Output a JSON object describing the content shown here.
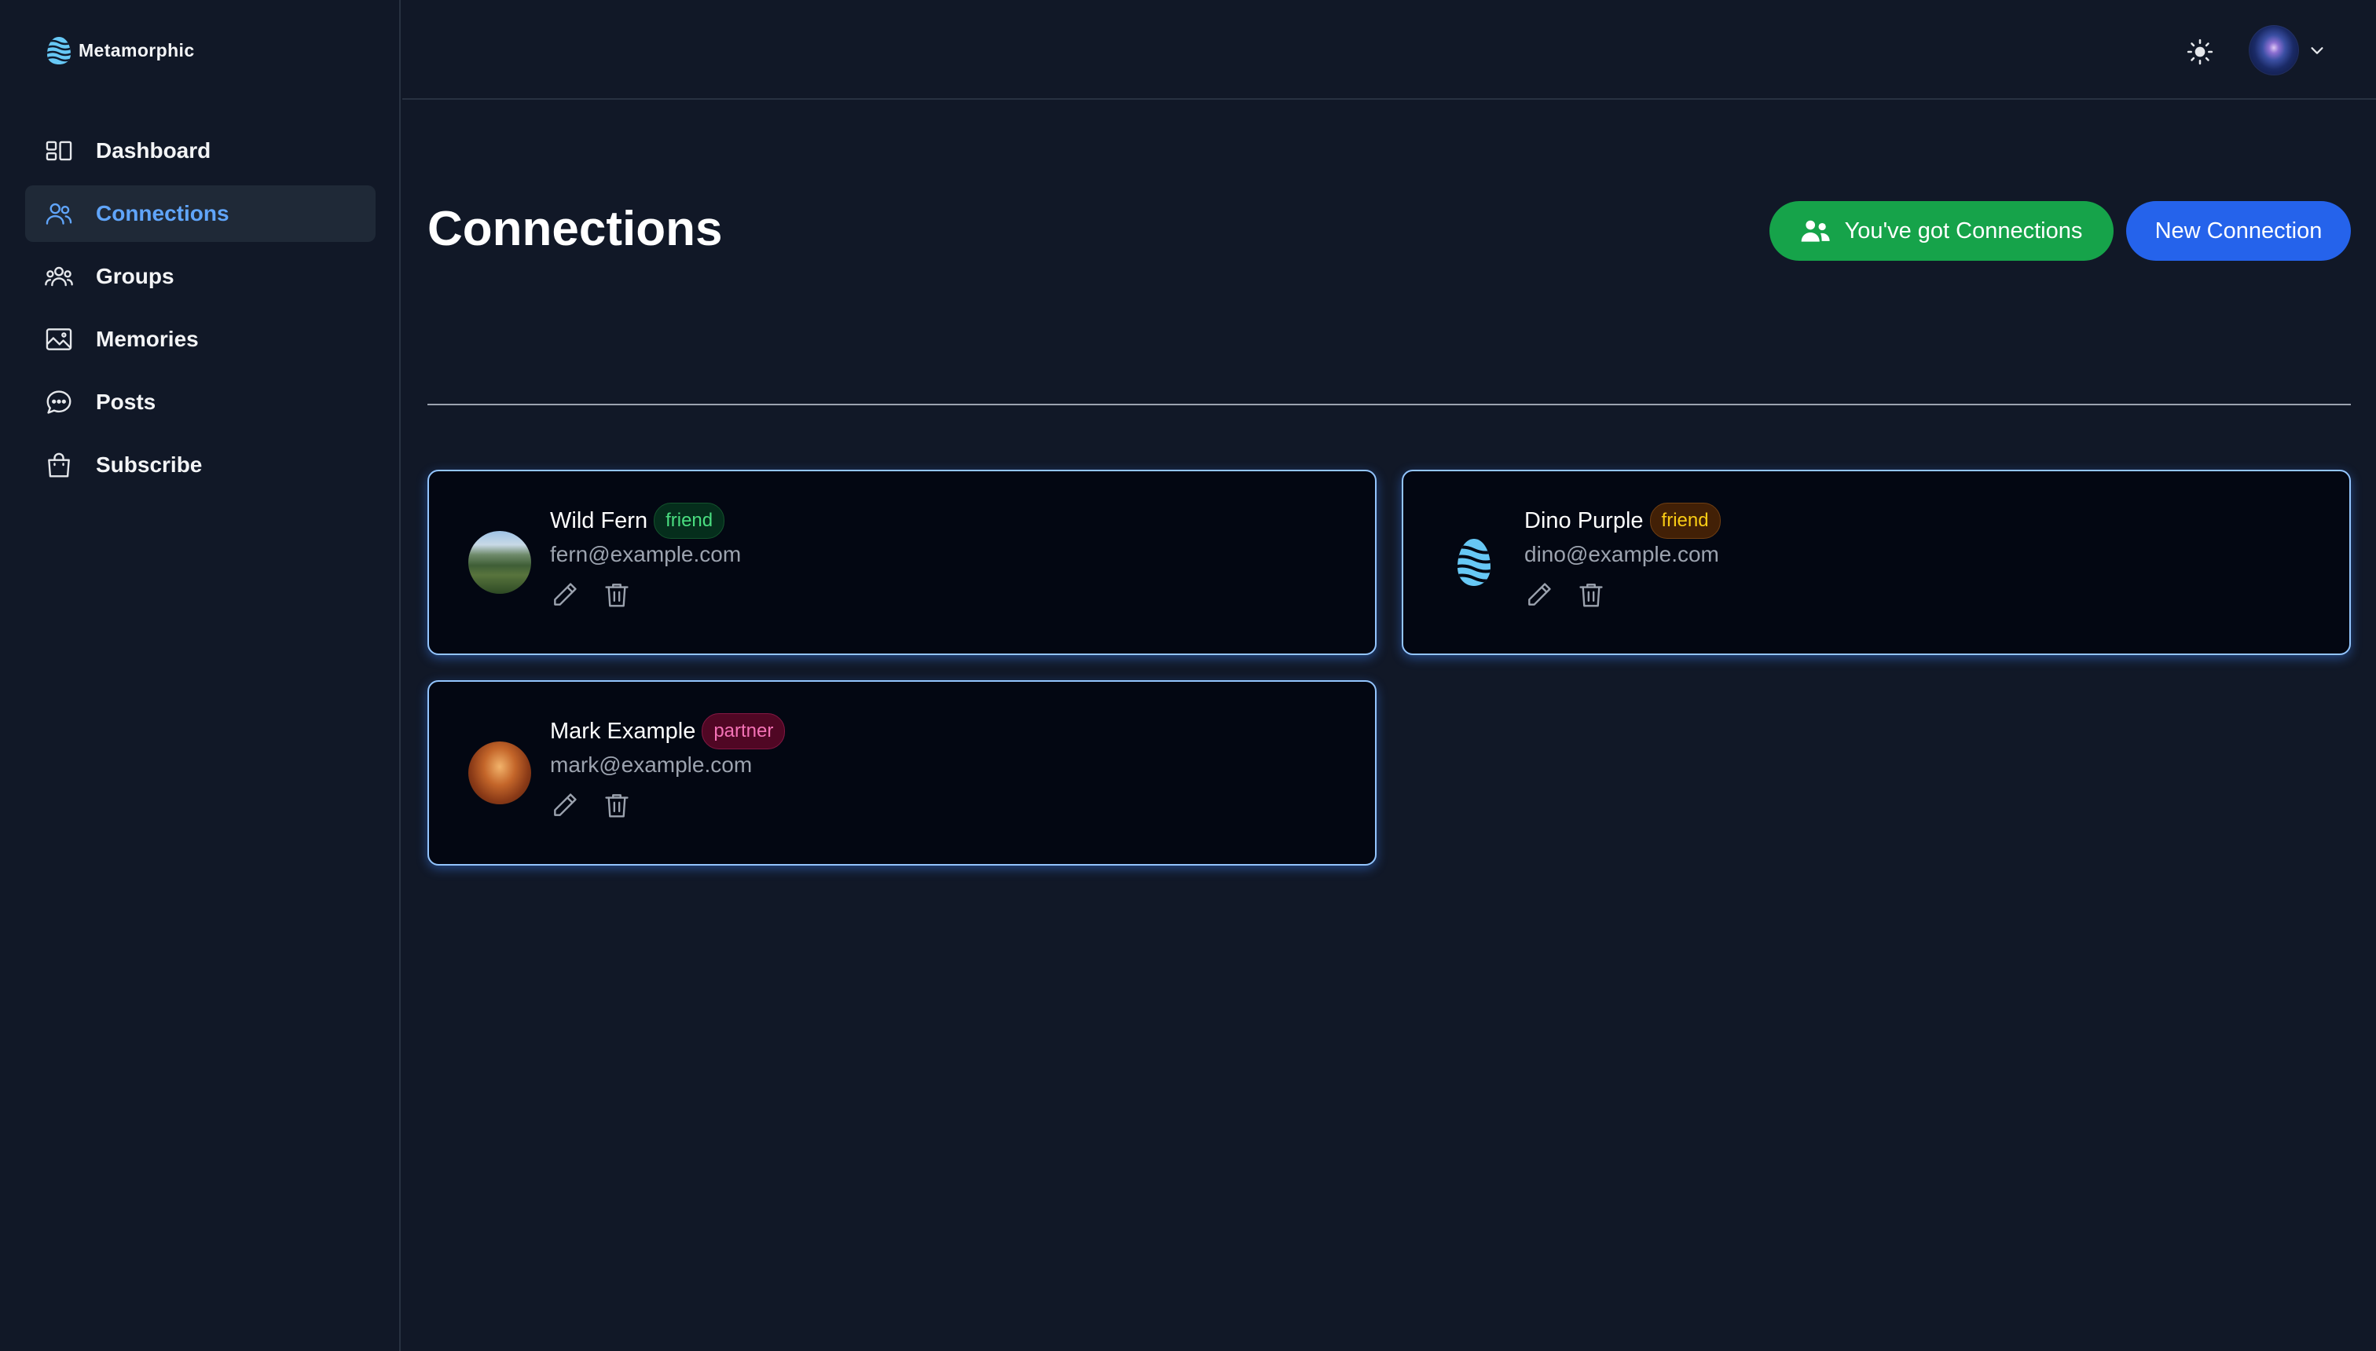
{
  "app": {
    "name": "Metamorphic"
  },
  "sidebar": {
    "items": [
      {
        "label": "Dashboard",
        "icon": "dashboard-icon",
        "active": false
      },
      {
        "label": "Connections",
        "icon": "users-icon",
        "active": true
      },
      {
        "label": "Groups",
        "icon": "user-group-icon",
        "active": false
      },
      {
        "label": "Memories",
        "icon": "photo-icon",
        "active": false
      },
      {
        "label": "Posts",
        "icon": "chat-bubble-icon",
        "active": false
      },
      {
        "label": "Subscribe",
        "icon": "shopping-bag-icon",
        "active": false
      }
    ]
  },
  "topbar": {
    "theme_icon": "sun-icon",
    "user_menu_icon": "chevron-down-icon"
  },
  "page": {
    "title": "Connections",
    "primary_action": "You've got Connections",
    "secondary_action": "New Connection"
  },
  "connections": [
    {
      "name": "Wild Fern",
      "label": "friend",
      "label_color": "#4ade80",
      "email": "fern@example.com"
    },
    {
      "name": "Dino Purple",
      "label": "friend",
      "label_color": "#facc15",
      "email": "dino@example.com"
    },
    {
      "name": "Mark Example",
      "label": "partner",
      "label_color": "#f472b6",
      "email": "mark@example.com"
    }
  ],
  "colors": {
    "background": "#111827",
    "card_background": "#030712",
    "card_border": "#93c5fd",
    "accent_active": "#60a5fa",
    "green_button": "#16a34a",
    "blue_button": "#2563eb"
  }
}
